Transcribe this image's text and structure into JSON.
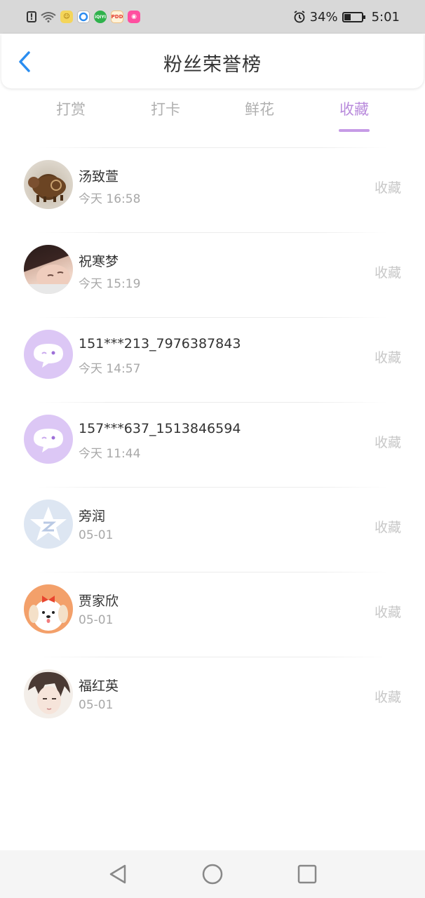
{
  "status_bar": {
    "battery_percent": "34%",
    "time": "5:01",
    "icons": [
      "sim-alert-icon",
      "wifi-icon",
      "app-icon-yellow",
      "app-icon-blue",
      "app-icon-iqiyi",
      "app-icon-pdd",
      "app-icon-pink",
      "alarm-icon",
      "battery-icon"
    ]
  },
  "header": {
    "title": "粉丝荣誉榜",
    "back_icon": "chevron-left-icon"
  },
  "tabs": [
    {
      "label": "打赏",
      "active": false
    },
    {
      "label": "打卡",
      "active": false
    },
    {
      "label": "鲜花",
      "active": false
    },
    {
      "label": "收藏",
      "active": true
    }
  ],
  "accent_color": "#c69be6",
  "list": [
    {
      "name": "汤致萱",
      "time": "今天 16:58",
      "action": "收藏",
      "avatar": "pig-figurine-avatar"
    },
    {
      "name": "祝寒梦",
      "time": "今天 15:19",
      "action": "收藏",
      "avatar": "photo-person-avatar"
    },
    {
      "name": "151***213_7976387843",
      "time": "今天 14:57",
      "action": "收藏",
      "avatar": "default-chat-avatar"
    },
    {
      "name": "157***637_1513846594",
      "time": "今天 11:44",
      "action": "收藏",
      "avatar": "default-chat-avatar"
    },
    {
      "name": "旁润",
      "time": "05-01",
      "action": "收藏",
      "avatar": "star-logo-avatar"
    },
    {
      "name": "贾家欣",
      "time": "05-01",
      "action": "收藏",
      "avatar": "cartoon-dog-avatar"
    },
    {
      "name": "福红英",
      "time": "05-01",
      "action": "收藏",
      "avatar": "anime-boy-avatar"
    }
  ],
  "nav_bar": {
    "back": "triangle-back-icon",
    "home": "circle-home-icon",
    "recents": "square-recents-icon"
  }
}
